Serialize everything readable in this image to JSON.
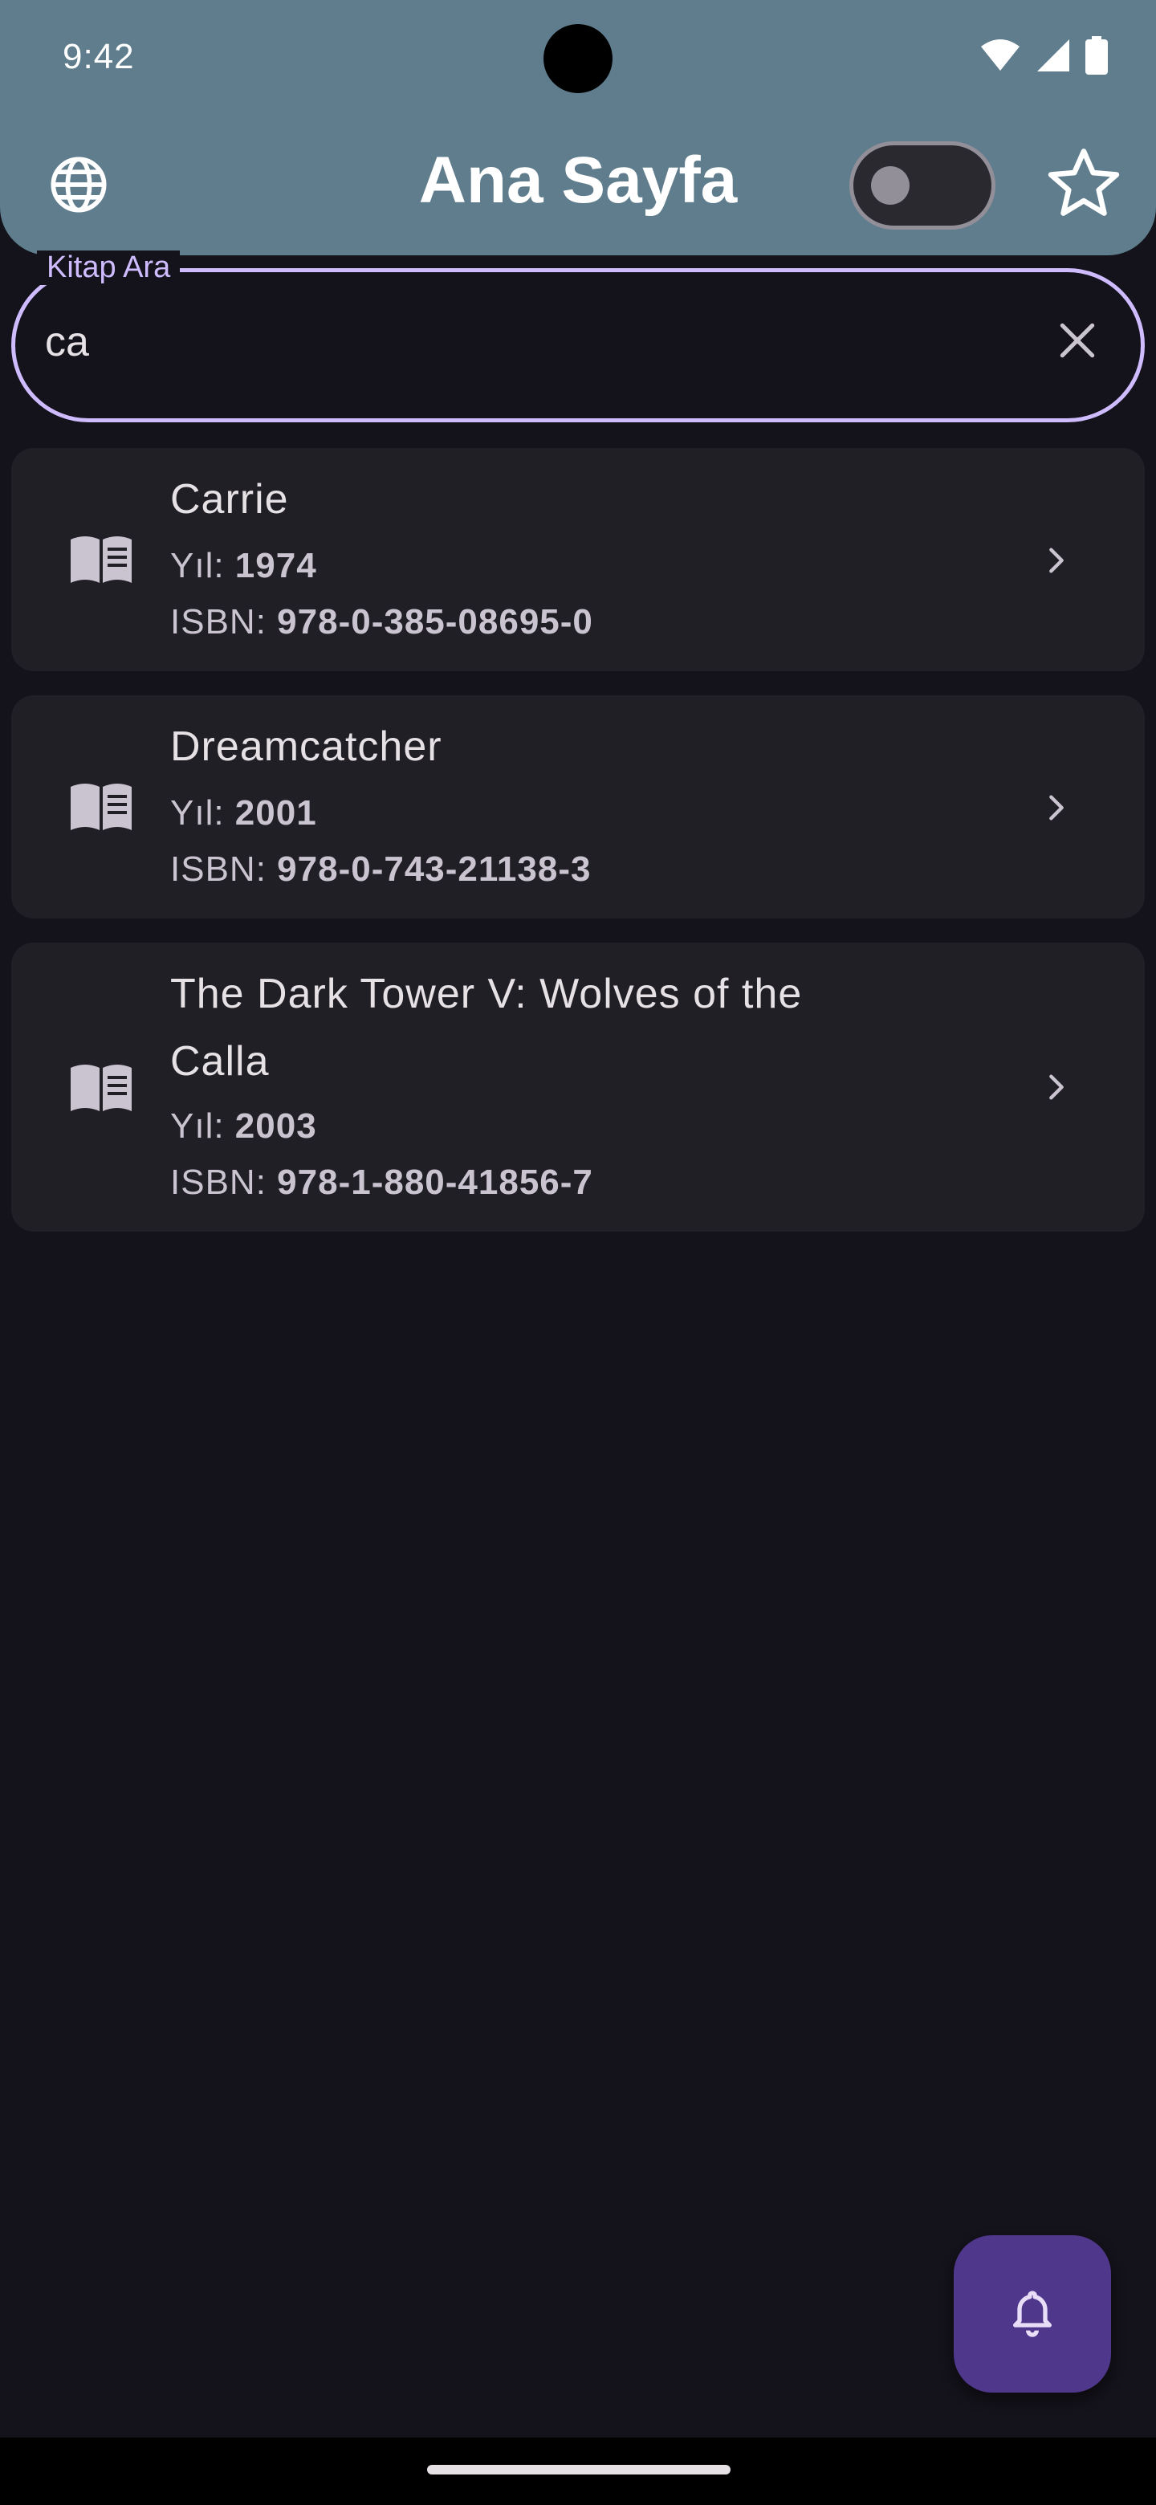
{
  "status_bar": {
    "time": "9:42"
  },
  "app_bar": {
    "title": "Ana Sayfa",
    "language_icon": "globe-icon",
    "favorites_icon": "star-outline-icon",
    "theme_toggle_on": false
  },
  "search": {
    "label": "Kitap Ara",
    "value": "ca",
    "clear_icon": "close-icon"
  },
  "results": [
    {
      "title_line1": "Carrie",
      "title_line2": "",
      "year_label": "Yıl: ",
      "year": "1974",
      "isbn_label": "ISBN: ",
      "isbn": "978-0-385-08695-0"
    },
    {
      "title_line1": "Dreamcatcher",
      "title_line2": "",
      "year_label": "Yıl: ",
      "year": "2001",
      "isbn_label": "ISBN: ",
      "isbn": "978-0-743-21138-3"
    },
    {
      "title_line1": "The Dark Tower V: Wolves of the",
      "title_line2": "Calla",
      "year_label": "Yıl: ",
      "year": "2003",
      "isbn_label": "ISBN: ",
      "isbn": "978-1-880-41856-7"
    }
  ],
  "fab": {
    "icon": "bell-icon"
  },
  "colors": {
    "app_bar": "#5f7d8c",
    "background": "#14121a",
    "card": "#211f26",
    "accent": "#cfbcff",
    "fab": "#4f378b"
  }
}
